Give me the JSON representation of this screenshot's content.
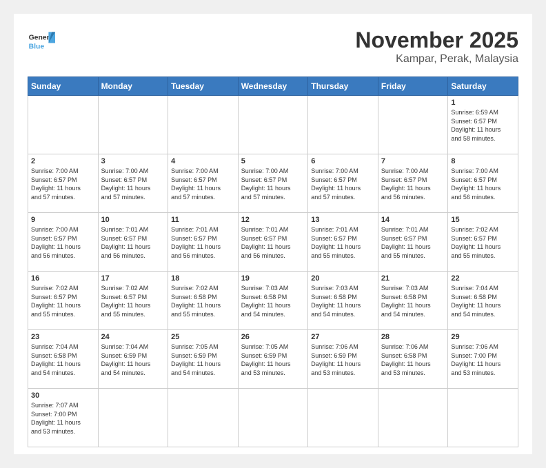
{
  "header": {
    "logo_general": "General",
    "logo_blue": "Blue",
    "month": "November 2025",
    "location": "Kampar, Perak, Malaysia"
  },
  "weekdays": [
    "Sunday",
    "Monday",
    "Tuesday",
    "Wednesday",
    "Thursday",
    "Friday",
    "Saturday"
  ],
  "weeks": [
    [
      {
        "day": "",
        "info": ""
      },
      {
        "day": "",
        "info": ""
      },
      {
        "day": "",
        "info": ""
      },
      {
        "day": "",
        "info": ""
      },
      {
        "day": "",
        "info": ""
      },
      {
        "day": "",
        "info": ""
      },
      {
        "day": "1",
        "info": "Sunrise: 6:59 AM\nSunset: 6:57 PM\nDaylight: 11 hours\nand 58 minutes."
      }
    ],
    [
      {
        "day": "2",
        "info": "Sunrise: 7:00 AM\nSunset: 6:57 PM\nDaylight: 11 hours\nand 57 minutes."
      },
      {
        "day": "3",
        "info": "Sunrise: 7:00 AM\nSunset: 6:57 PM\nDaylight: 11 hours\nand 57 minutes."
      },
      {
        "day": "4",
        "info": "Sunrise: 7:00 AM\nSunset: 6:57 PM\nDaylight: 11 hours\nand 57 minutes."
      },
      {
        "day": "5",
        "info": "Sunrise: 7:00 AM\nSunset: 6:57 PM\nDaylight: 11 hours\nand 57 minutes."
      },
      {
        "day": "6",
        "info": "Sunrise: 7:00 AM\nSunset: 6:57 PM\nDaylight: 11 hours\nand 57 minutes."
      },
      {
        "day": "7",
        "info": "Sunrise: 7:00 AM\nSunset: 6:57 PM\nDaylight: 11 hours\nand 56 minutes."
      },
      {
        "day": "8",
        "info": "Sunrise: 7:00 AM\nSunset: 6:57 PM\nDaylight: 11 hours\nand 56 minutes."
      }
    ],
    [
      {
        "day": "9",
        "info": "Sunrise: 7:00 AM\nSunset: 6:57 PM\nDaylight: 11 hours\nand 56 minutes."
      },
      {
        "day": "10",
        "info": "Sunrise: 7:01 AM\nSunset: 6:57 PM\nDaylight: 11 hours\nand 56 minutes."
      },
      {
        "day": "11",
        "info": "Sunrise: 7:01 AM\nSunset: 6:57 PM\nDaylight: 11 hours\nand 56 minutes."
      },
      {
        "day": "12",
        "info": "Sunrise: 7:01 AM\nSunset: 6:57 PM\nDaylight: 11 hours\nand 56 minutes."
      },
      {
        "day": "13",
        "info": "Sunrise: 7:01 AM\nSunset: 6:57 PM\nDaylight: 11 hours\nand 55 minutes."
      },
      {
        "day": "14",
        "info": "Sunrise: 7:01 AM\nSunset: 6:57 PM\nDaylight: 11 hours\nand 55 minutes."
      },
      {
        "day": "15",
        "info": "Sunrise: 7:02 AM\nSunset: 6:57 PM\nDaylight: 11 hours\nand 55 minutes."
      }
    ],
    [
      {
        "day": "16",
        "info": "Sunrise: 7:02 AM\nSunset: 6:57 PM\nDaylight: 11 hours\nand 55 minutes."
      },
      {
        "day": "17",
        "info": "Sunrise: 7:02 AM\nSunset: 6:57 PM\nDaylight: 11 hours\nand 55 minutes."
      },
      {
        "day": "18",
        "info": "Sunrise: 7:02 AM\nSunset: 6:58 PM\nDaylight: 11 hours\nand 55 minutes."
      },
      {
        "day": "19",
        "info": "Sunrise: 7:03 AM\nSunset: 6:58 PM\nDaylight: 11 hours\nand 54 minutes."
      },
      {
        "day": "20",
        "info": "Sunrise: 7:03 AM\nSunset: 6:58 PM\nDaylight: 11 hours\nand 54 minutes."
      },
      {
        "day": "21",
        "info": "Sunrise: 7:03 AM\nSunset: 6:58 PM\nDaylight: 11 hours\nand 54 minutes."
      },
      {
        "day": "22",
        "info": "Sunrise: 7:04 AM\nSunset: 6:58 PM\nDaylight: 11 hours\nand 54 minutes."
      }
    ],
    [
      {
        "day": "23",
        "info": "Sunrise: 7:04 AM\nSunset: 6:58 PM\nDaylight: 11 hours\nand 54 minutes."
      },
      {
        "day": "24",
        "info": "Sunrise: 7:04 AM\nSunset: 6:59 PM\nDaylight: 11 hours\nand 54 minutes."
      },
      {
        "day": "25",
        "info": "Sunrise: 7:05 AM\nSunset: 6:59 PM\nDaylight: 11 hours\nand 54 minutes."
      },
      {
        "day": "26",
        "info": "Sunrise: 7:05 AM\nSunset: 6:59 PM\nDaylight: 11 hours\nand 53 minutes."
      },
      {
        "day": "27",
        "info": "Sunrise: 7:06 AM\nSunset: 6:59 PM\nDaylight: 11 hours\nand 53 minutes."
      },
      {
        "day": "28",
        "info": "Sunrise: 7:06 AM\nSunset: 6:58 PM\nDaylight: 11 hours\nand 53 minutes."
      },
      {
        "day": "29",
        "info": "Sunrise: 7:06 AM\nSunset: 7:00 PM\nDaylight: 11 hours\nand 53 minutes."
      }
    ],
    [
      {
        "day": "30",
        "info": "Sunrise: 7:07 AM\nSunset: 7:00 PM\nDaylight: 11 hours\nand 53 minutes."
      },
      {
        "day": "",
        "info": ""
      },
      {
        "day": "",
        "info": ""
      },
      {
        "day": "",
        "info": ""
      },
      {
        "day": "",
        "info": ""
      },
      {
        "day": "",
        "info": ""
      },
      {
        "day": "",
        "info": ""
      }
    ]
  ]
}
